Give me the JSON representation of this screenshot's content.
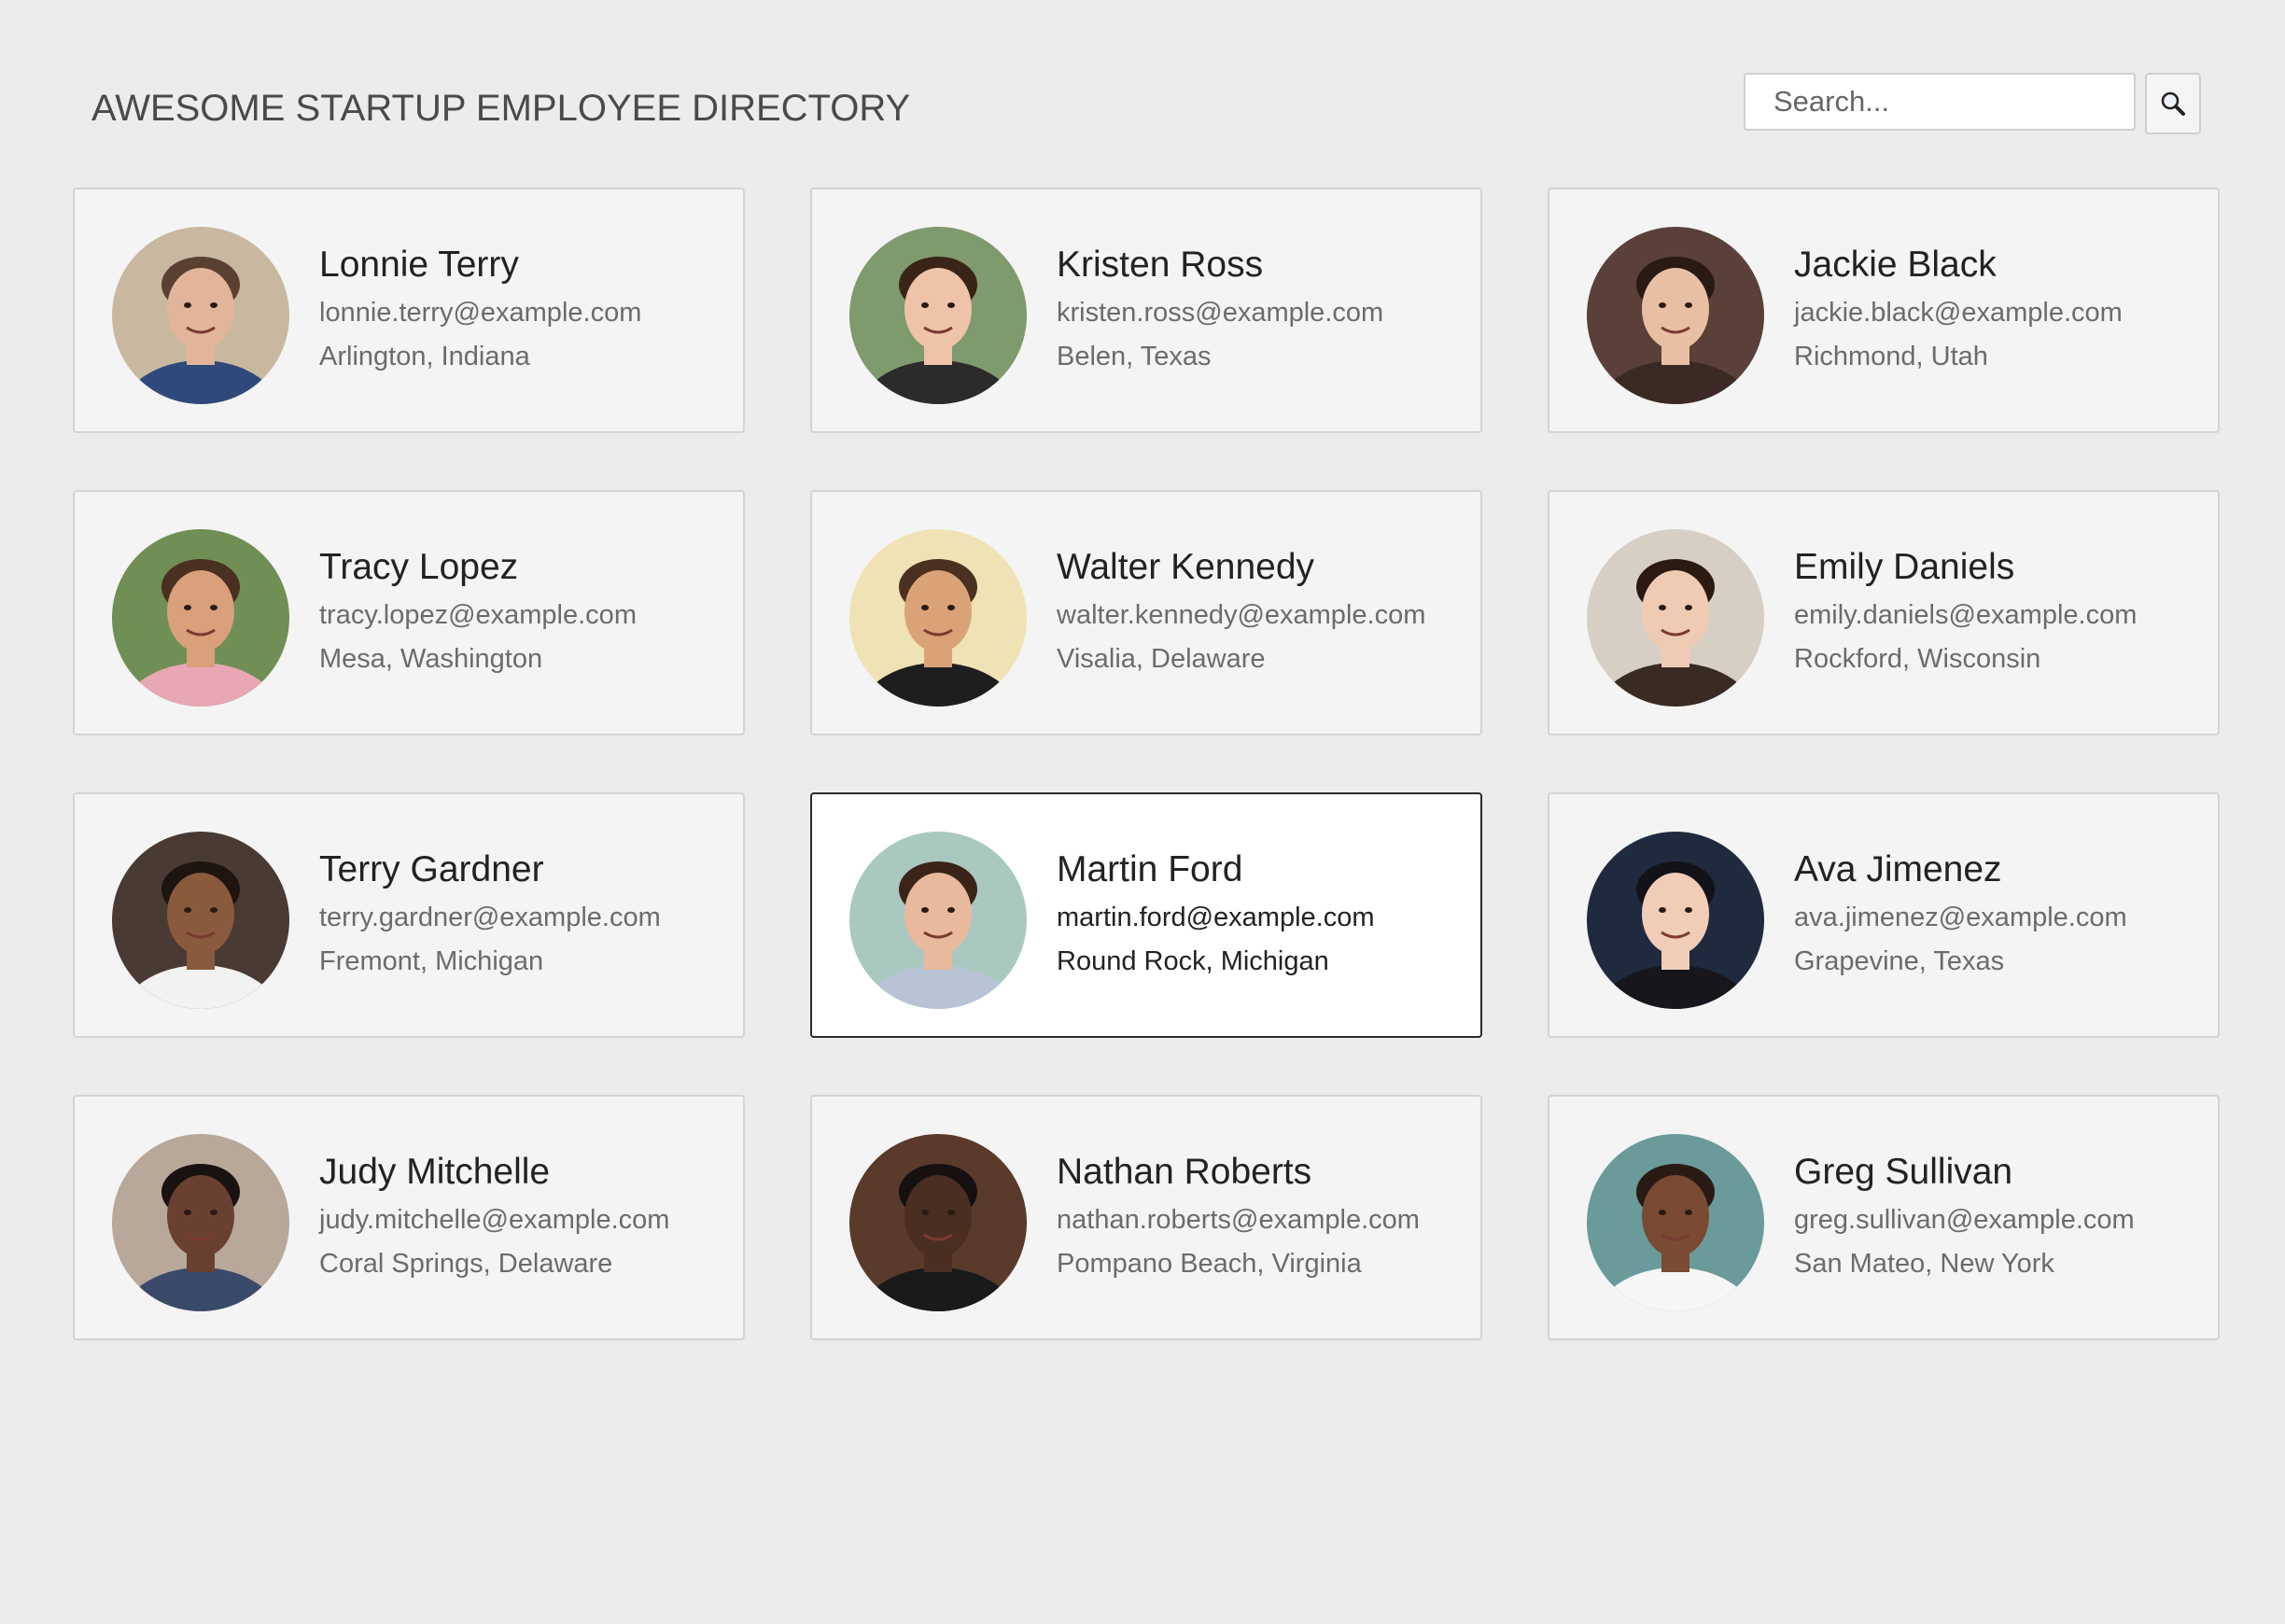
{
  "header": {
    "title": "AWESOME STARTUP EMPLOYEE DIRECTORY",
    "search_placeholder": "Search...",
    "search_icon": "magnifier-icon"
  },
  "employees": [
    {
      "name": "Lonnie Terry",
      "email": "lonnie.terry@example.com",
      "location": "Arlington, Indiana",
      "skin": "#e2b59a",
      "hair": "#5a4030",
      "shirt": "#2f4a7a",
      "bg": "#c9b8a0",
      "selected": false
    },
    {
      "name": "Kristen Ross",
      "email": "kristen.ross@example.com",
      "location": "Belen, Texas",
      "skin": "#eec3a8",
      "hair": "#3a2418",
      "shirt": "#2b2b2b",
      "bg": "#7f9a6c",
      "selected": false
    },
    {
      "name": "Jackie Black",
      "email": "jackie.black@example.com",
      "location": "Richmond, Utah",
      "skin": "#e9bfa3",
      "hair": "#2a1a14",
      "shirt": "#3b2a24",
      "bg": "#5a4038",
      "selected": false
    },
    {
      "name": "Tracy Lopez",
      "email": "tracy.lopez@example.com",
      "location": "Mesa, Washington",
      "skin": "#d9a07c",
      "hair": "#4a3020",
      "shirt": "#e8a7b5",
      "bg": "#6f8f55",
      "selected": false
    },
    {
      "name": "Walter Kennedy",
      "email": "walter.kennedy@example.com",
      "location": "Visalia, Delaware",
      "skin": "#d9a277",
      "hair": "#4a3020",
      "shirt": "#1e1e1e",
      "bg": "#efe2b4",
      "selected": false
    },
    {
      "name": "Emily Daniels",
      "email": "emily.daniels@example.com",
      "location": "Rockford, Wisconsin",
      "skin": "#f0cbb3",
      "hair": "#2b1a12",
      "shirt": "#3a2a24",
      "bg": "#d8cfc4",
      "selected": false
    },
    {
      "name": "Terry Gardner",
      "email": "terry.gardner@example.com",
      "location": "Fremont, Michigan",
      "skin": "#8a5a3c",
      "hair": "#1e1410",
      "shirt": "#f2f2f2",
      "bg": "#4a3a34",
      "selected": false
    },
    {
      "name": "Martin Ford",
      "email": "martin.ford@example.com",
      "location": "Round Rock, Michigan",
      "skin": "#e8b99c",
      "hair": "#3a2418",
      "shirt": "#b8c4d6",
      "bg": "#a9c8c0",
      "selected": true
    },
    {
      "name": "Ava Jimenez",
      "email": "ava.jimenez@example.com",
      "location": "Grapevine, Texas",
      "skin": "#f1cdb8",
      "hair": "#121218",
      "shirt": "#16161c",
      "bg": "#1f2a3e",
      "selected": false
    },
    {
      "name": "Judy Mitchelle",
      "email": "judy.mitchelle@example.com",
      "location": "Coral Springs, Delaware",
      "skin": "#6a4030",
      "hair": "#1a1210",
      "shirt": "#3a4a6a",
      "bg": "#b8a89a",
      "selected": false
    },
    {
      "name": "Nathan Roberts",
      "email": "nathan.roberts@example.com",
      "location": "Pompano Beach, Virginia",
      "skin": "#4a2e22",
      "hair": "#161010",
      "shirt": "#1a1a1a",
      "bg": "#5a3a2a",
      "selected": false
    },
    {
      "name": "Greg Sullivan",
      "email": "greg.sullivan@example.com",
      "location": "San Mateo, New York",
      "skin": "#7a4a32",
      "hair": "#2a1a14",
      "shirt": "#f6f6f6",
      "bg": "#6a9a9a",
      "selected": false
    }
  ]
}
